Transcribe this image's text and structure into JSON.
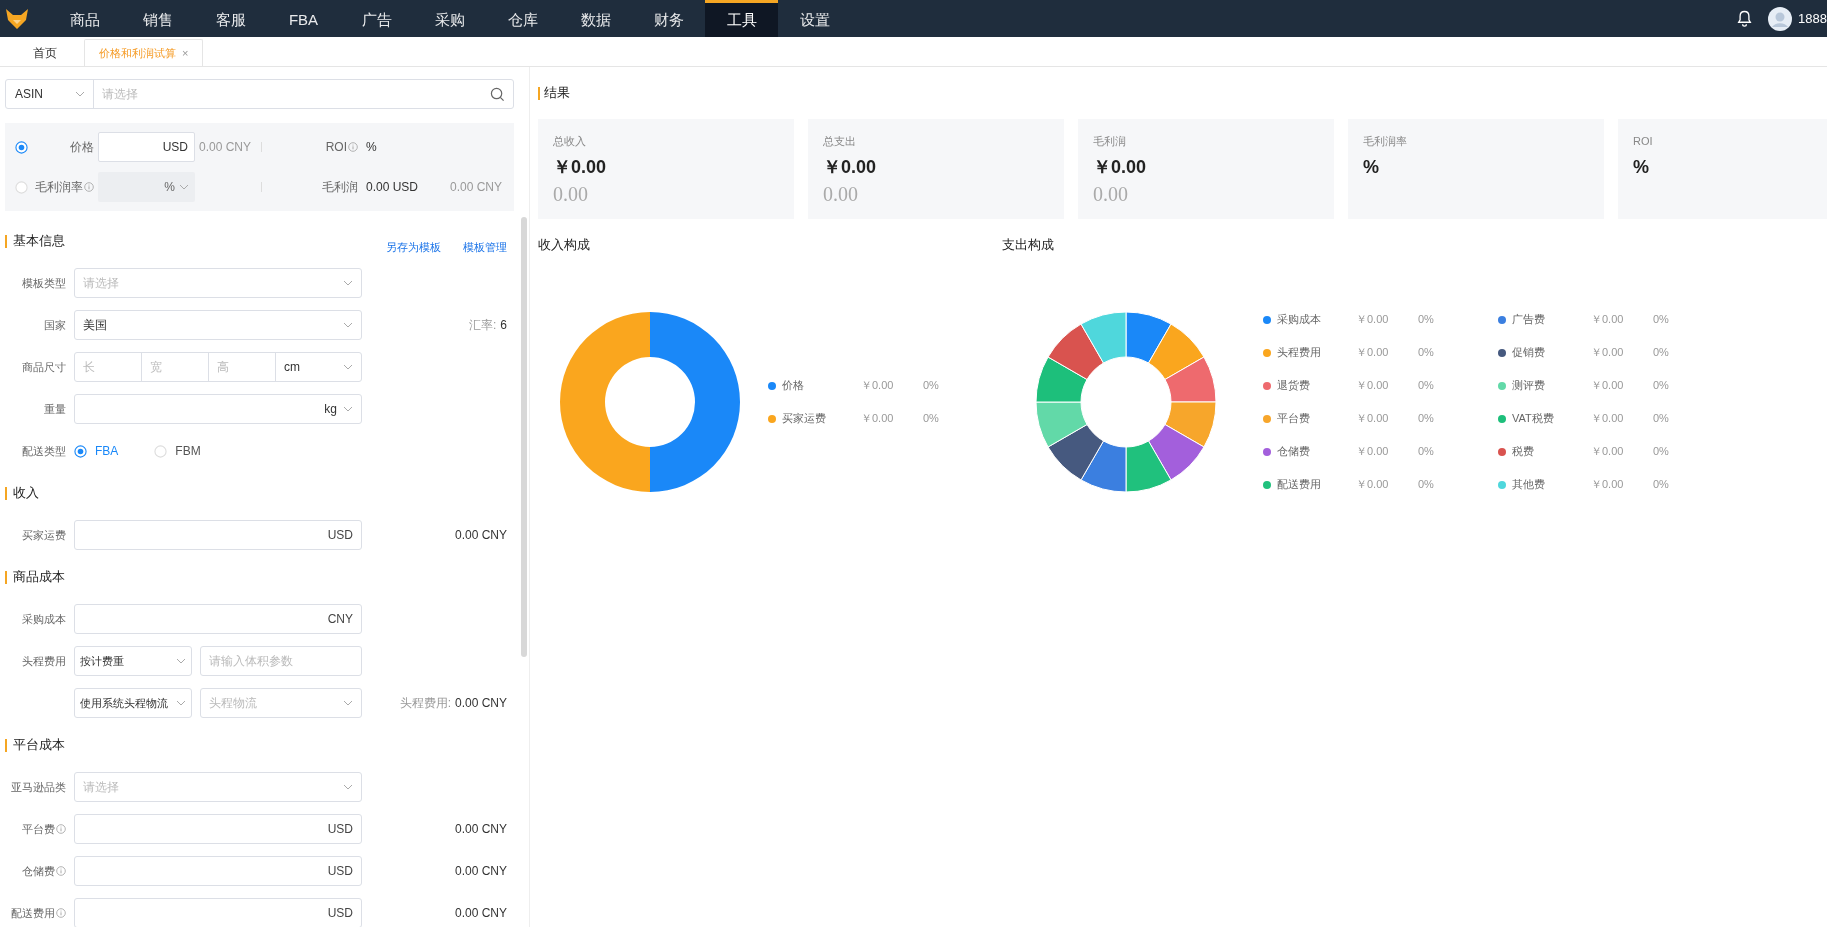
{
  "nav": {
    "items": [
      {
        "label": "商品",
        "selected": false
      },
      {
        "label": "销售",
        "selected": false
      },
      {
        "label": "客服",
        "selected": false
      },
      {
        "label": "FBA",
        "selected": false
      },
      {
        "label": "广告",
        "selected": false
      },
      {
        "label": "采购",
        "selected": false
      },
      {
        "label": "仓库",
        "selected": false
      },
      {
        "label": "数据",
        "selected": false
      },
      {
        "label": "财务",
        "selected": false
      },
      {
        "label": "工具",
        "selected": true
      },
      {
        "label": "设置",
        "selected": false
      }
    ],
    "user": "1888"
  },
  "tabs": [
    {
      "label": "首页",
      "selected": false
    },
    {
      "label": "价格和利润试算",
      "selected": true,
      "close": "×"
    }
  ],
  "search": {
    "type": "ASIN",
    "placeholder": "请选择"
  },
  "calc": [
    {
      "selected": true,
      "label": "价格",
      "help": false,
      "unit": "USD",
      "converted": "0.00 CNY",
      "metric_label": "ROI",
      "metric_help": true,
      "metric_value": "%"
    },
    {
      "selected": false,
      "label": "毛利润率",
      "help": true,
      "unit": "%",
      "metric_label": "毛利润",
      "metric_help": false,
      "metric_value": "0.00 USD",
      "metric_converted": "0.00 CNY"
    }
  ],
  "sections": [
    {
      "title": "基本信息",
      "actions": [
        "另存为模板",
        "模板管理"
      ],
      "fields": [
        {
          "kind": "select",
          "label": "模板类型",
          "placeholder": "请选择"
        },
        {
          "kind": "select",
          "label": "国家",
          "value": "美国",
          "aside_label": "汇率:",
          "aside_value": "6"
        },
        {
          "kind": "dimensions",
          "label": "商品尺寸",
          "placeholders": [
            "长",
            "宽",
            "高"
          ],
          "unit": "cm"
        },
        {
          "kind": "unit-select",
          "label": "重量",
          "unit": "kg"
        },
        {
          "kind": "radio",
          "label": "配送类型",
          "options": [
            {
              "label": "FBA",
              "selected": true
            },
            {
              "label": "FBM",
              "selected": false
            }
          ]
        }
      ]
    },
    {
      "title": "收入",
      "fields": [
        {
          "kind": "amount",
          "label": "买家运费",
          "help": false,
          "unit": "USD",
          "aside_value": "0.00 CNY"
        }
      ]
    },
    {
      "title": "商品成本",
      "fields": [
        {
          "kind": "amount",
          "label": "采购成本",
          "help": false,
          "unit": "CNY"
        },
        {
          "kind": "dual",
          "label": "头程费用",
          "left": "按计费重",
          "right": {
            "kind": "input",
            "placeholder": "请输入体积参数"
          }
        },
        {
          "kind": "dual",
          "left": "使用系统头程物流",
          "right": {
            "kind": "select",
            "placeholder": "头程物流"
          },
          "aside_label": "头程费用:",
          "aside_value": "0.00 CNY"
        }
      ]
    },
    {
      "title": "平台成本",
      "fields": [
        {
          "kind": "select",
          "label": "亚马逊品类",
          "placeholder": "请选择"
        },
        {
          "kind": "amount",
          "label": "平台费",
          "help": true,
          "unit": "USD",
          "aside_value": "0.00 CNY"
        },
        {
          "kind": "amount",
          "label": "仓储费",
          "help": true,
          "unit": "USD",
          "aside_value": "0.00 CNY"
        },
        {
          "kind": "amount",
          "label": "配送费用",
          "help": true,
          "unit": "USD",
          "aside_value": "0.00 CNY"
        }
      ]
    }
  ],
  "result": {
    "title": "结果",
    "cards": [
      {
        "label": "总收入",
        "value": "￥0.00",
        "sub": "0.00"
      },
      {
        "label": "总支出",
        "value": "￥0.00",
        "sub": "0.00"
      },
      {
        "label": "毛利润",
        "value": "￥0.00",
        "sub": "0.00"
      },
      {
        "label": "毛利润率",
        "value": "%"
      },
      {
        "label": "ROI",
        "value": "%"
      }
    ]
  },
  "income": {
    "title": "收入构成",
    "legend": [
      {
        "label": "价格",
        "color": "#1a88f8",
        "amount": "￥0.00",
        "percent": "0%"
      },
      {
        "label": "买家运费",
        "color": "#faa61e",
        "amount": "￥0.00",
        "percent": "0%"
      }
    ]
  },
  "expense": {
    "title": "支出构成",
    "legend": [
      {
        "label": "采购成本",
        "color": "#1a88f8",
        "amount": "￥0.00",
        "percent": "0%"
      },
      {
        "label": "头程费用",
        "color": "#faa61e",
        "amount": "￥0.00",
        "percent": "0%"
      },
      {
        "label": "退货费",
        "color": "#ee6a6e",
        "amount": "￥0.00",
        "percent": "0%"
      },
      {
        "label": "平台费",
        "color": "#f7a62b",
        "amount": "￥0.00",
        "percent": "0%"
      },
      {
        "label": "仓储费",
        "color": "#a35fdc",
        "amount": "￥0.00",
        "percent": "0%"
      },
      {
        "label": "配送费用",
        "color": "#20c17d",
        "amount": "￥0.00",
        "percent": "0%"
      },
      {
        "label": "广告费",
        "color": "#3b7fe0",
        "amount": "￥0.00",
        "percent": "0%"
      },
      {
        "label": "促销费",
        "color": "#46597f",
        "amount": "￥0.00",
        "percent": "0%"
      },
      {
        "label": "测评费",
        "color": "#62d9a8",
        "amount": "￥0.00",
        "percent": "0%"
      },
      {
        "label": "VAT税费",
        "color": "#1dbf7b",
        "amount": "￥0.00",
        "percent": "0%"
      },
      {
        "label": "税费",
        "color": "#d9534f",
        "amount": "￥0.00",
        "percent": "0%"
      },
      {
        "label": "其他费",
        "color": "#4fd7dc",
        "amount": "￥0.00",
        "percent": "0%"
      }
    ]
  }
}
